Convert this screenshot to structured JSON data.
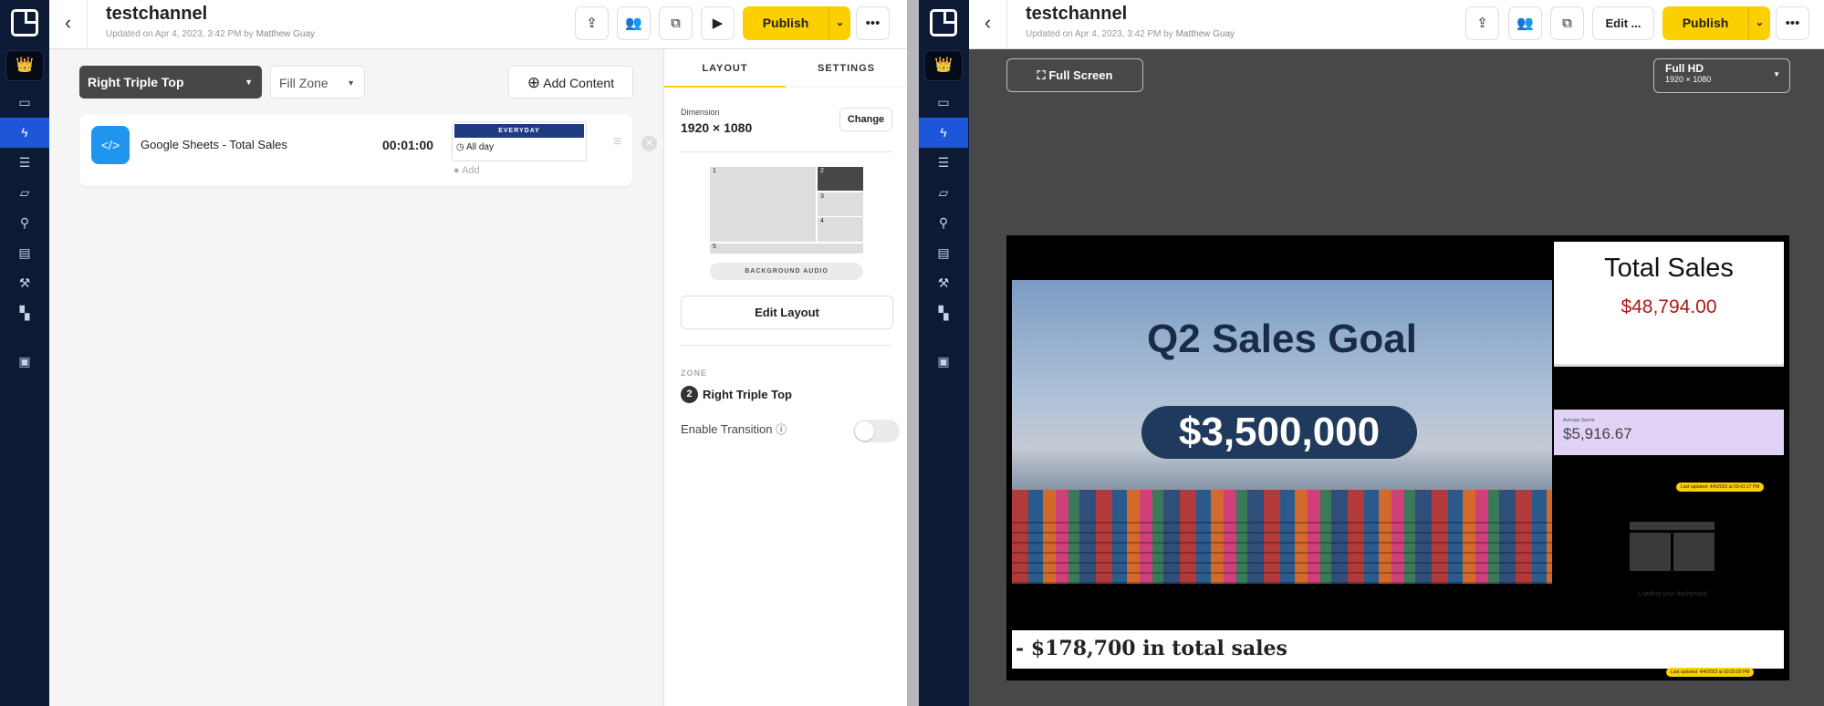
{
  "channel": {
    "title": "testchannel",
    "updated_prefix": "Updated on Apr 4, 2023, 3:42 PM by",
    "updated_by": "Matthew Guay"
  },
  "header": {
    "publish_label": "Publish",
    "edit_label": "Edit ..."
  },
  "sidebar": {
    "items": [
      "screens",
      "playlists-lightning",
      "channels",
      "media-folder",
      "links",
      "reports",
      "tools",
      "apps",
      "casting"
    ]
  },
  "editor": {
    "zone_select": "Right Triple Top",
    "fill_select": "Fill Zone",
    "add_content": "Add Content",
    "content_item": {
      "name": "Google Sheets - Total Sales",
      "duration": "00:01:00",
      "schedule_badge": "EVERYDAY",
      "schedule_time": "All day",
      "add_label": "Add"
    }
  },
  "layout_panel": {
    "tabs": [
      "LAYOUT",
      "SETTINGS"
    ],
    "dimension_label": "Dimension",
    "dimension_value": "1920 × 1080",
    "change_label": "Change",
    "zones": [
      "1",
      "2",
      "3",
      "4",
      "5"
    ],
    "background_audio": "BACKGROUND AUDIO",
    "edit_layout": "Edit Layout",
    "zone_heading": "ZONE",
    "zone_number": "2",
    "zone_name": "Right Triple Top",
    "enable_transition": "Enable Transition",
    "transition_enabled": false
  },
  "preview": {
    "full_screen": "Full Screen",
    "resolution_name": "Full HD",
    "resolution_value": "1920 × 1080",
    "headline": "Q2 Sales Goal",
    "goal_amount": "$3,500,000",
    "total_sales_title": "Total Sales",
    "total_sales_value": "$48,794.00",
    "avg_label": "Average Spend",
    "avg_value": "$5,916.67",
    "last_updated_1": "Last updated: 4/4/2023 at 03:41:17 PM",
    "loading": "Loading your dashboard",
    "ticker": "- $178,700 in total sales",
    "last_updated_2": "Last updated: 4/4/2023 at 03:25:00 PM"
  },
  "colors": {
    "accent": "#fcd000",
    "sidebar": "#0c1a36",
    "active": "#1d56d8",
    "sales_red": "#b01818",
    "avg_bg": "#e0d3f5"
  }
}
